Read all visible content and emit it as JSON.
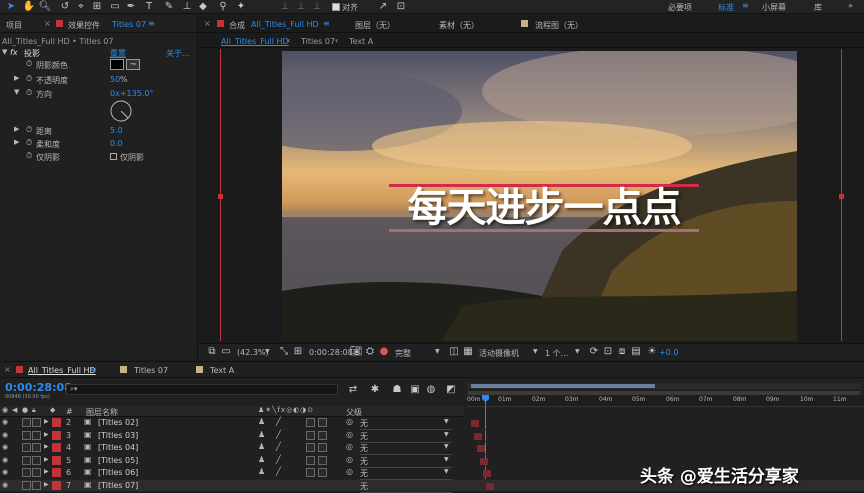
{
  "toolbar": {
    "workspaces": [
      "必要项",
      "标准",
      "小屏幕",
      "库"
    ],
    "active_workspace": "标准",
    "align_label": "对齐",
    "menu_glyph": "≡",
    "more_glyph": "»"
  },
  "left_panel": {
    "tab_project": "项目",
    "tab_effects": "效果控件",
    "tab_effects_layer": "Titles 07",
    "breadcrumb": "All_Titles_Full HD • Titles 07",
    "effect": {
      "fx": "fx",
      "name": "投影",
      "reset": "重置",
      "about": "关于..."
    },
    "props": [
      {
        "name": "阴影颜色",
        "value": ""
      },
      {
        "name": "不透明度",
        "value": "50",
        "unit": "%"
      },
      {
        "name": "方向",
        "value": "0x+135.0°"
      },
      {
        "name": "距离",
        "value": "5.0"
      },
      {
        "name": "柔和度",
        "value": "0.0"
      },
      {
        "name": "仅阴影",
        "value": "仅阴影"
      }
    ]
  },
  "comp_panel": {
    "tab_label": "合成",
    "tab_name": "All_Titles_Full HD",
    "tab_menu": "≡",
    "layer_tab": "图层（无）",
    "footage_tab": "素材（无）",
    "flow_tab": "流程图（无）",
    "crumbs": [
      "All_Titles_Full HD",
      "Titles 07",
      "Text A"
    ],
    "title_text": "每天进步一点点",
    "zoom": "(42.3%)",
    "timecode": "0:00:28:08",
    "quality": "完整",
    "camera": "活动摄像机",
    "views": "1 个...",
    "exposure": "+0.0"
  },
  "timeline": {
    "tabs": [
      "All_Titles_Full HD",
      "Titles 07",
      "Text A"
    ],
    "tab_menu": "≡",
    "timecode": "0:00:28:08",
    "frame_info": "00848 (30.00 fps)",
    "search_glyph": "⌕▾",
    "col_hash": "#",
    "col_layer_name": "图层名称",
    "col_parent": "父级",
    "ruler": [
      "00m",
      "01m",
      "02m",
      "03m",
      "04m",
      "05m",
      "06m",
      "07m",
      "08m",
      "09m",
      "10m",
      "11m"
    ],
    "layers": [
      {
        "index": "2",
        "name": "[Titles 02]",
        "parent": "无"
      },
      {
        "index": "3",
        "name": "[Titles 03]",
        "parent": "无"
      },
      {
        "index": "4",
        "name": "[Titles 04]",
        "parent": "无"
      },
      {
        "index": "5",
        "name": "[Titles 05]",
        "parent": "无"
      },
      {
        "index": "6",
        "name": "[Titles 06]",
        "parent": "无"
      },
      {
        "index": "7",
        "name": "[Titles 07]",
        "parent": "无"
      }
    ]
  },
  "watermark": "头条 @爱生活分享家",
  "colors": {
    "accent": "#2d8ceb",
    "label_red": "#c0353a",
    "bar_red": "#d42a4a",
    "bar_mauve": "#a0707e"
  }
}
